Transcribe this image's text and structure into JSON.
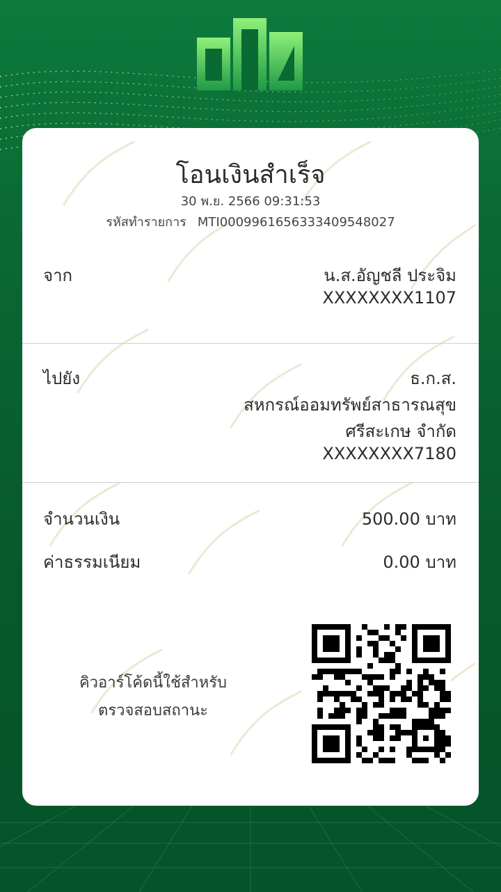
{
  "receipt": {
    "title": "โอนเงินสำเร็จ",
    "datetime": "30 พ.ย. 2566 09:31:53",
    "txn_label": "รหัสทำรายการ",
    "txn_id": "MTI0009961656333409548027"
  },
  "from": {
    "label": "จาก",
    "name": "น.ส.อัญชลี ประจิม",
    "account": "XXXXXXXX1107"
  },
  "to": {
    "label": "ไปยัง",
    "bank": "ธ.ก.ส.",
    "name_line1": "สหกรณ์ออมทรัพย์สาธารณสุข",
    "name_line2": "ศรีสะเกษ จำกัด",
    "account": "XXXXXXXX7180"
  },
  "amount": {
    "label": "จำนวนเงิน",
    "value": "500.00 บาท"
  },
  "fee": {
    "label": "ค่าธรรมเนียม",
    "value": "0.00 บาท"
  },
  "qr": {
    "caption_line1": "คิวอาร์โค้ดนี้ใช้สำหรับ",
    "caption_line2": "ตรวจสอบสถานะ"
  },
  "colors": {
    "brand_green": "#0a6a33",
    "logo_green": "#4fc85a"
  },
  "icons": {
    "logo": "baac-logo-icon",
    "background_pattern": "rice-stalk-pattern",
    "qr": "qr-code-icon"
  }
}
